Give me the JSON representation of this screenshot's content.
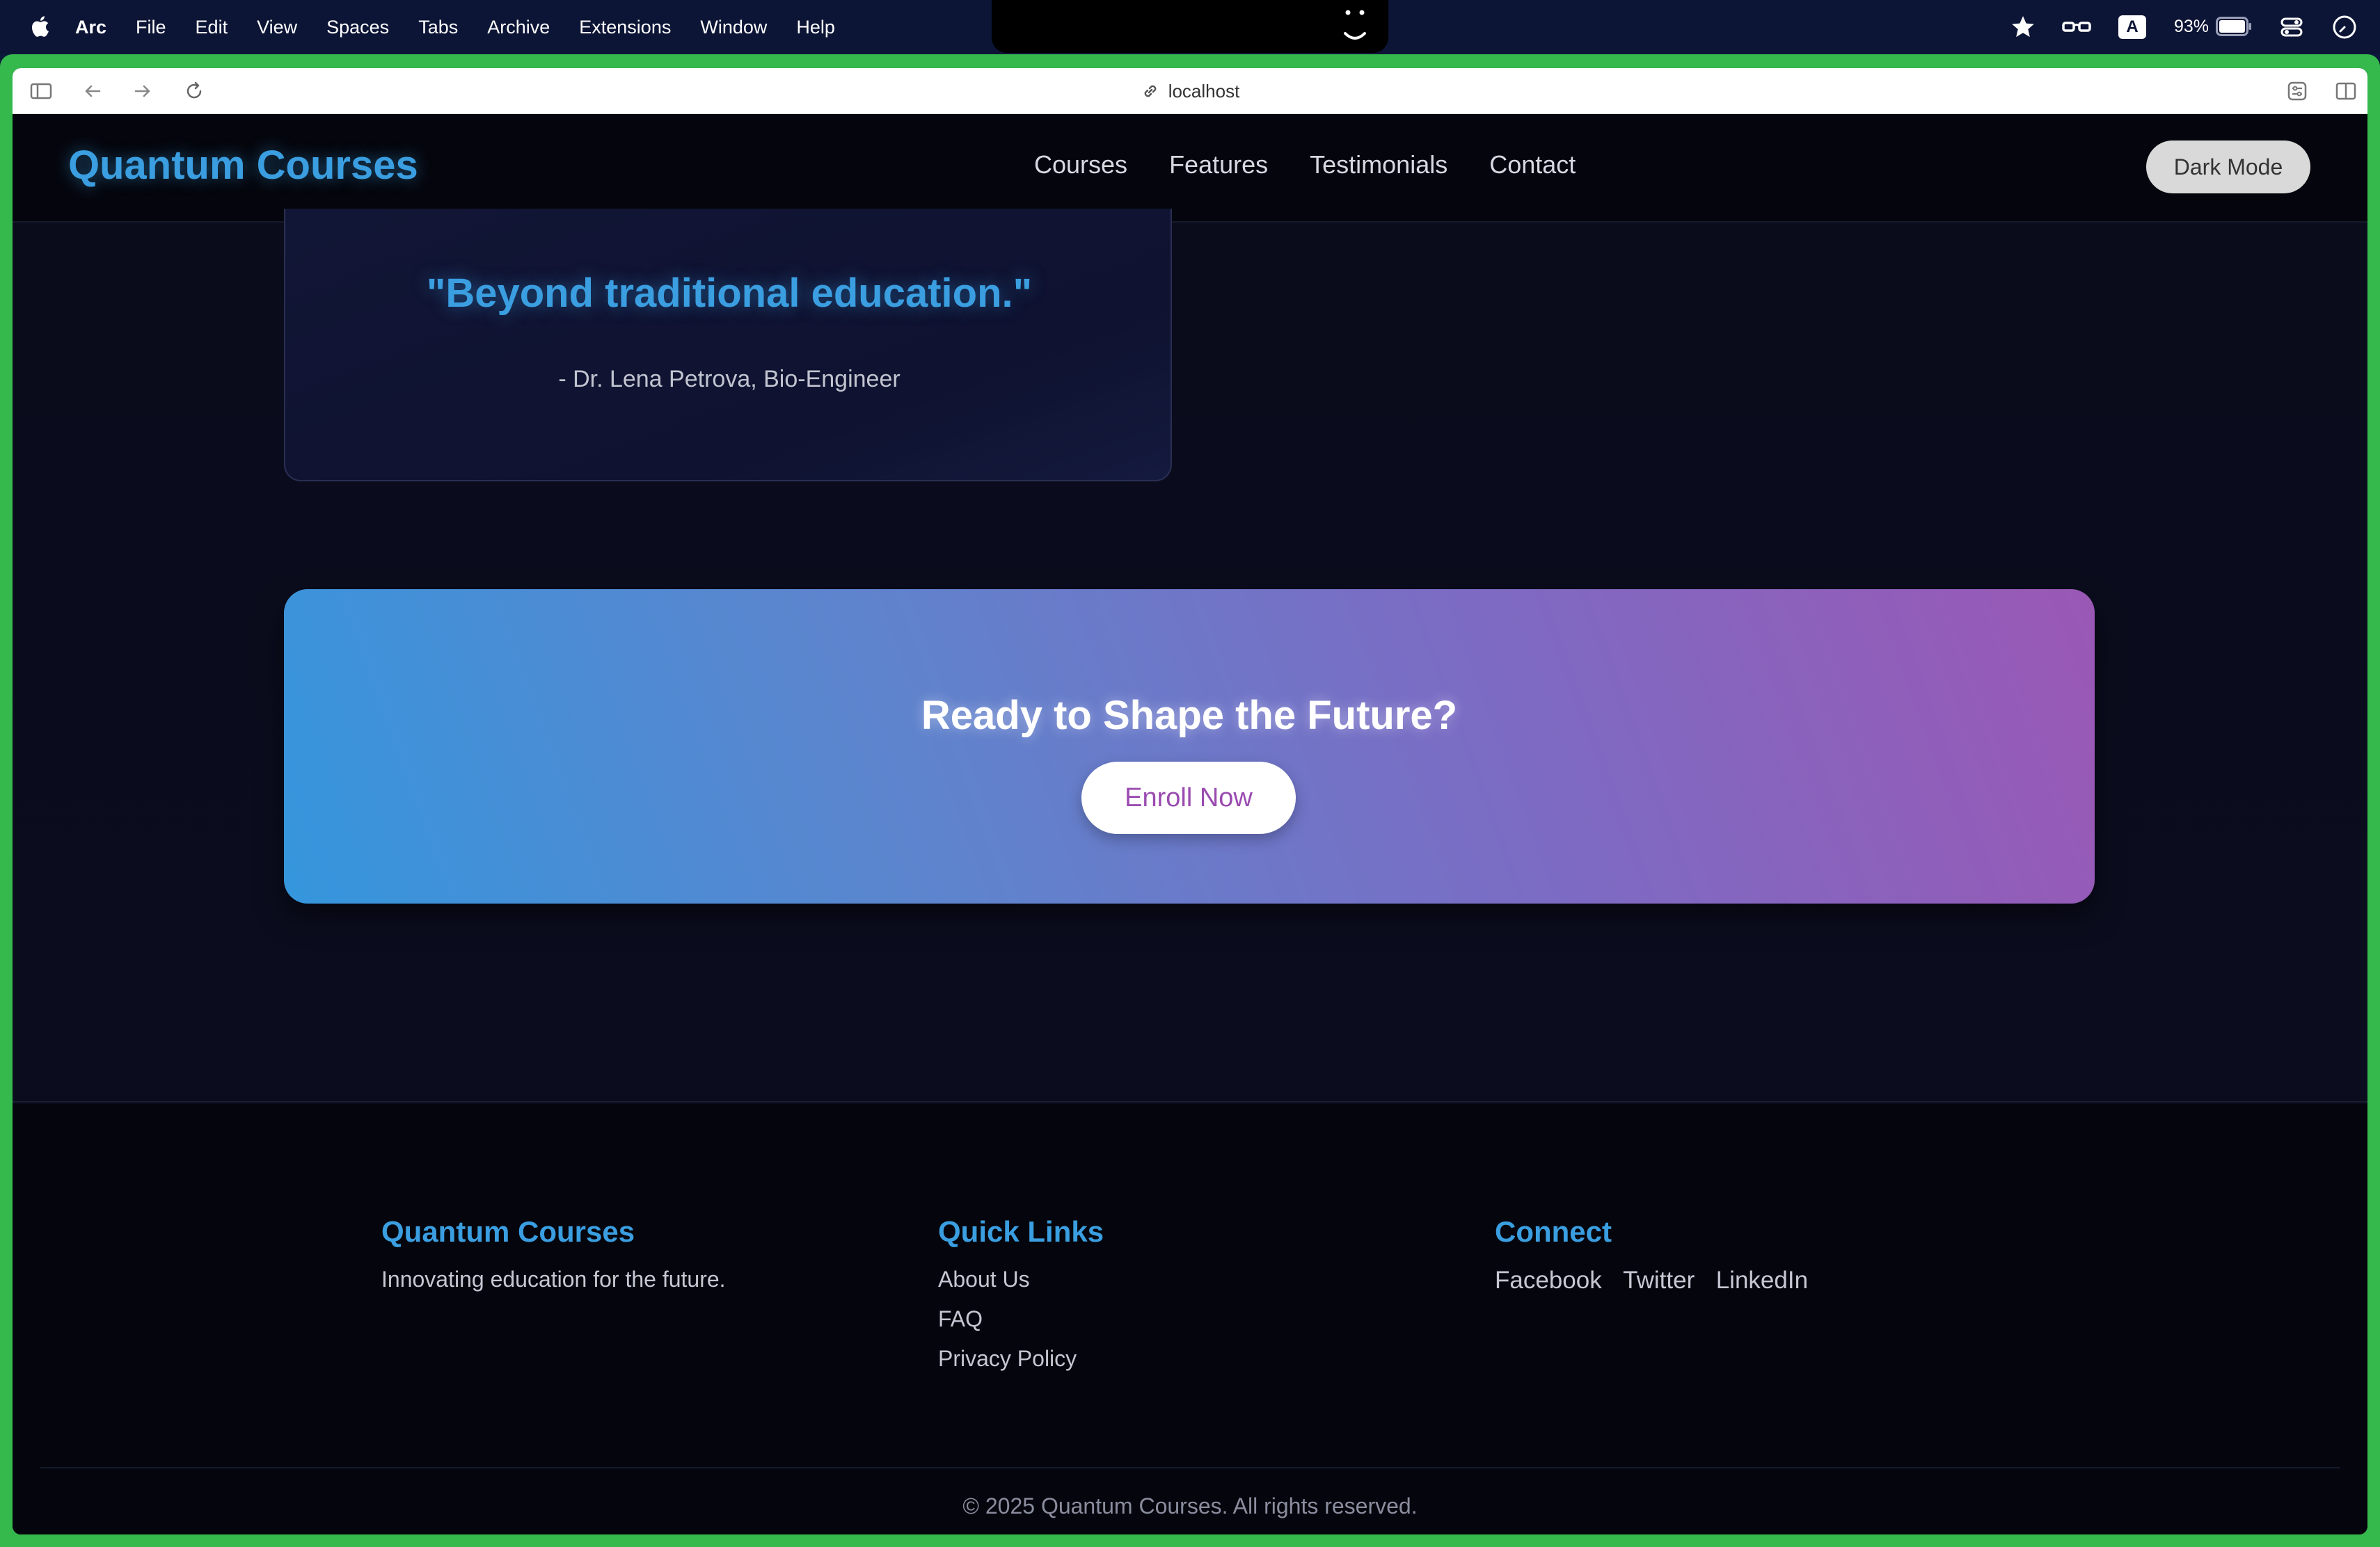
{
  "menubar": {
    "app": "Arc",
    "items": [
      "File",
      "Edit",
      "View",
      "Spaces",
      "Tabs",
      "Archive",
      "Extensions",
      "Window",
      "Help"
    ],
    "battery": "93%",
    "input_source": "A"
  },
  "browser": {
    "url": "localhost"
  },
  "site": {
    "brand": "Quantum Courses",
    "nav": [
      "Courses",
      "Features",
      "Testimonials",
      "Contact"
    ],
    "dark_mode_label": "Dark Mode"
  },
  "testimonial": {
    "quote": "\"Beyond traditional education.\"",
    "author": "- Dr. Lena Petrova, Bio-Engineer"
  },
  "cta": {
    "title": "Ready to Shape the Future?",
    "button": "Enroll Now"
  },
  "footer": {
    "about": {
      "title": "Quantum Courses",
      "text": "Innovating education for the future."
    },
    "quick_links": {
      "title": "Quick Links",
      "items": [
        "About Us",
        "FAQ",
        "Privacy Policy"
      ]
    },
    "connect": {
      "title": "Connect",
      "items": [
        "Facebook",
        "Twitter",
        "LinkedIn"
      ]
    },
    "copyright": "© 2025 Quantum Courses. All rights reserved."
  },
  "colors": {
    "accent": "#3a9ee0",
    "frame": "#35b84c",
    "cta_start": "#3596dd",
    "cta_end": "#9a58b5"
  }
}
